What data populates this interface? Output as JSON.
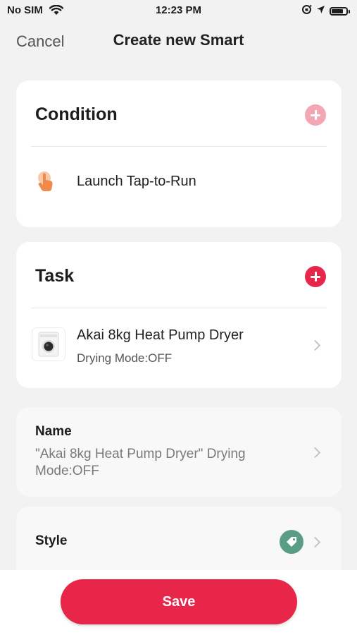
{
  "status_bar": {
    "carrier": "No SIM",
    "time": "12:23 PM"
  },
  "nav": {
    "cancel_label": "Cancel",
    "title": "Create new Smart"
  },
  "condition": {
    "header": "Condition",
    "item_label": "Launch Tap-to-Run"
  },
  "task": {
    "header": "Task",
    "device_name": "Akai 8kg Heat Pump Dryer",
    "device_action": "Drying Mode:OFF"
  },
  "name_section": {
    "label": "Name",
    "value": "\"Akai 8kg Heat Pump Dryer\" Drying Mode:OFF"
  },
  "style_section": {
    "label": "Style"
  },
  "save_label": "Save",
  "colors": {
    "accent": "#e8264a",
    "accent_muted": "#f3a6b4",
    "style_tag": "#5a9d85",
    "hand_icon": "#f08a4b"
  },
  "icons": [
    "wifi-icon",
    "location-icon",
    "lock-rotation-icon",
    "battery-icon",
    "add-icon",
    "hand-tap-icon",
    "dryer-icon",
    "chevron-right-icon",
    "tag-icon"
  ]
}
